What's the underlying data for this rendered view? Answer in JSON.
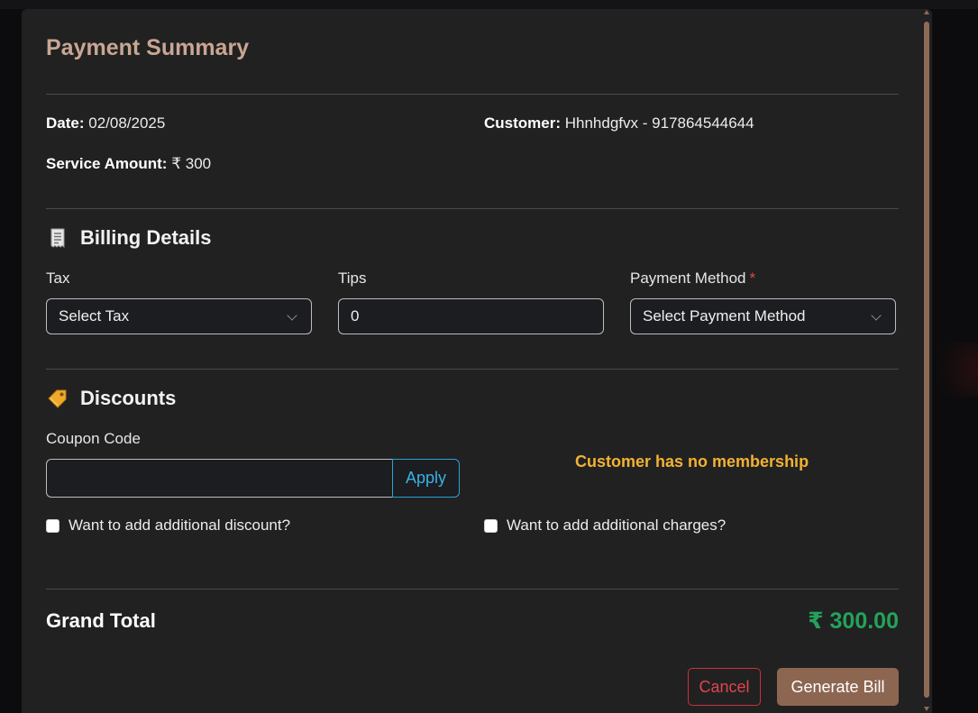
{
  "modal": {
    "title": "Payment Summary"
  },
  "summary": {
    "date_label": "Date:",
    "date_value": "02/08/2025",
    "customer_label": "Customer:",
    "customer_value": "Hhnhdgfvx - 917864544644",
    "service_amount_label": "Service Amount:",
    "service_amount_value": "₹ 300"
  },
  "billing": {
    "heading": "Billing Details",
    "icon": "receipt-icon",
    "tax_label": "Tax",
    "tax_value": "Select Tax",
    "tips_label": "Tips",
    "tips_value": "0",
    "payment_method_label": "Payment Method",
    "payment_method_required": "*",
    "payment_method_value": "Select Payment Method"
  },
  "discounts": {
    "heading": "Discounts",
    "icon": "tag-icon",
    "coupon_label": "Coupon Code",
    "coupon_value": "",
    "apply_label": "Apply",
    "membership_note": "Customer has no membership",
    "additional_discount_label": "Want to add additional discount?",
    "additional_charges_label": "Want to add additional charges?"
  },
  "totals": {
    "grand_total_label": "Grand Total",
    "grand_total_value": "₹ 300.00"
  },
  "actions": {
    "cancel_label": "Cancel",
    "generate_label": "Generate Bill"
  },
  "colors": {
    "title": "#c9a693",
    "accent_brown": "#8c6650",
    "apply_blue": "#38b2e6",
    "membership_note": "#f2b233",
    "grand_total": "#23a35a",
    "cancel_red": "#e0454b"
  }
}
